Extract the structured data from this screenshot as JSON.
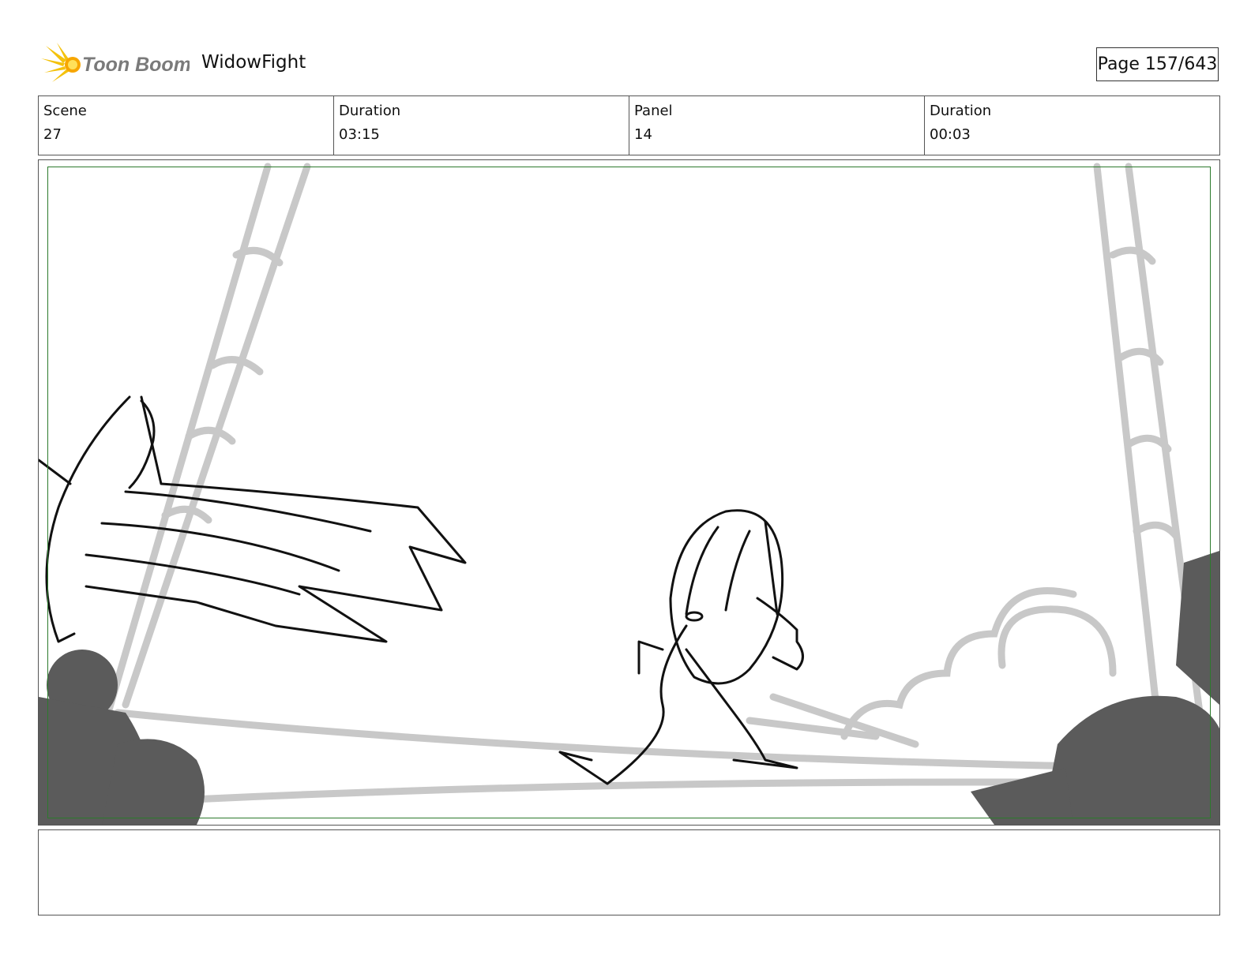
{
  "header": {
    "brand": "Toon Boom",
    "project_title": "WidowFight",
    "page_label": "Page 157/643"
  },
  "info": {
    "scene_label": "Scene",
    "scene_value": "27",
    "scene_duration_label": "Duration",
    "scene_duration_value": "03:15",
    "panel_label": "Panel",
    "panel_value": "14",
    "panel_duration_label": "Duration",
    "panel_duration_value": "00:03"
  },
  "panel": {
    "image": "storyboard-sketch",
    "safe_frame_color": "#2c7a2c"
  },
  "colors": {
    "brand_text": "#7a7a7a",
    "logo_burst": "#f4c20d",
    "sketch_ink": "#111111",
    "background_sketch": "#c8c8c8",
    "foreground_props": "#5b5b5b"
  },
  "notes": {
    "text": ""
  }
}
